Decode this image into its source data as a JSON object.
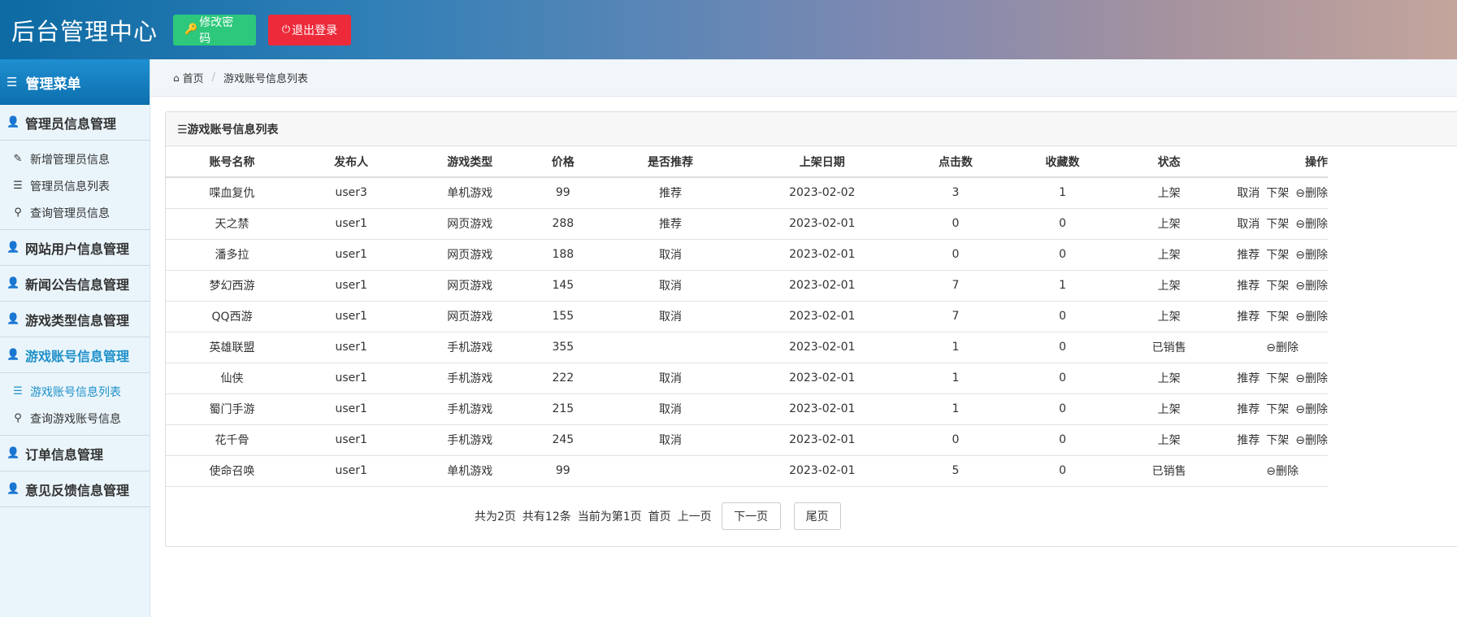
{
  "header": {
    "title": "后台管理中心",
    "change_password": "修改密码",
    "logout": "退出登录"
  },
  "sidebar": {
    "menu_title": "管理菜单",
    "groups": [
      {
        "label": "管理员信息管理",
        "items": [
          "新增管理员信息",
          "管理员信息列表",
          "查询管理员信息"
        ]
      },
      {
        "label": "网站用户信息管理"
      },
      {
        "label": "新闻公告信息管理"
      },
      {
        "label": "游戏类型信息管理"
      },
      {
        "label": "游戏账号信息管理",
        "items": [
          "游戏账号信息列表",
          "查询游戏账号信息"
        ]
      },
      {
        "label": "订单信息管理"
      },
      {
        "label": "意见反馈信息管理"
      }
    ]
  },
  "breadcrumb": {
    "home": "首页",
    "current": "游戏账号信息列表"
  },
  "panel": {
    "title": "☰游戏账号信息列表"
  },
  "table": {
    "headers": [
      "账号名称",
      "发布人",
      "游戏类型",
      "价格",
      "是否推荐",
      "上架日期",
      "点击数",
      "收藏数",
      "状态",
      "操作"
    ],
    "rows": [
      {
        "name": "喋血复仇",
        "publisher": "user3",
        "type": "单机游戏",
        "price": "99",
        "recommend": "推荐",
        "date": "2023-02-02",
        "clicks": "3",
        "favs": "1",
        "status": "上架",
        "ops": [
          "取消",
          "下架",
          "删除"
        ]
      },
      {
        "name": "天之禁",
        "publisher": "user1",
        "type": "网页游戏",
        "price": "288",
        "recommend": "推荐",
        "date": "2023-02-01",
        "clicks": "0",
        "favs": "0",
        "status": "上架",
        "ops": [
          "取消",
          "下架",
          "删除"
        ]
      },
      {
        "name": "潘多拉",
        "publisher": "user1",
        "type": "网页游戏",
        "price": "188",
        "recommend": "取消",
        "date": "2023-02-01",
        "clicks": "0",
        "favs": "0",
        "status": "上架",
        "ops": [
          "推荐",
          "下架",
          "删除"
        ]
      },
      {
        "name": "梦幻西游",
        "publisher": "user1",
        "type": "网页游戏",
        "price": "145",
        "recommend": "取消",
        "date": "2023-02-01",
        "clicks": "7",
        "favs": "1",
        "status": "上架",
        "ops": [
          "推荐",
          "下架",
          "删除"
        ]
      },
      {
        "name": "QQ西游",
        "publisher": "user1",
        "type": "网页游戏",
        "price": "155",
        "recommend": "取消",
        "date": "2023-02-01",
        "clicks": "7",
        "favs": "0",
        "status": "上架",
        "ops": [
          "推荐",
          "下架",
          "删除"
        ]
      },
      {
        "name": "英雄联盟",
        "publisher": "user1",
        "type": "手机游戏",
        "price": "355",
        "recommend": "",
        "date": "2023-02-01",
        "clicks": "1",
        "favs": "0",
        "status": "已销售",
        "ops": [
          "删除"
        ]
      },
      {
        "name": "仙侠",
        "publisher": "user1",
        "type": "手机游戏",
        "price": "222",
        "recommend": "取消",
        "date": "2023-02-01",
        "clicks": "1",
        "favs": "0",
        "status": "上架",
        "ops": [
          "推荐",
          "下架",
          "删除"
        ]
      },
      {
        "name": "蜀门手游",
        "publisher": "user1",
        "type": "手机游戏",
        "price": "215",
        "recommend": "取消",
        "date": "2023-02-01",
        "clicks": "1",
        "favs": "0",
        "status": "上架",
        "ops": [
          "推荐",
          "下架",
          "删除"
        ]
      },
      {
        "name": "花千骨",
        "publisher": "user1",
        "type": "手机游戏",
        "price": "245",
        "recommend": "取消",
        "date": "2023-02-01",
        "clicks": "0",
        "favs": "0",
        "status": "上架",
        "ops": [
          "推荐",
          "下架",
          "删除"
        ]
      },
      {
        "name": "使命召唤",
        "publisher": "user1",
        "type": "单机游戏",
        "price": "99",
        "recommend": "",
        "date": "2023-02-01",
        "clicks": "5",
        "favs": "0",
        "status": "已销售",
        "ops": [
          "删除"
        ]
      }
    ]
  },
  "pager": {
    "total_pages": "共为2页",
    "total_records": "共有12条",
    "current": "当前为第1页",
    "first": "首页",
    "prev": "上一页",
    "next": "下一页",
    "last": "尾页"
  },
  "colors": {
    "accent": "#1e90c9",
    "green": "#2dc87b",
    "red": "#ed2a3a"
  }
}
